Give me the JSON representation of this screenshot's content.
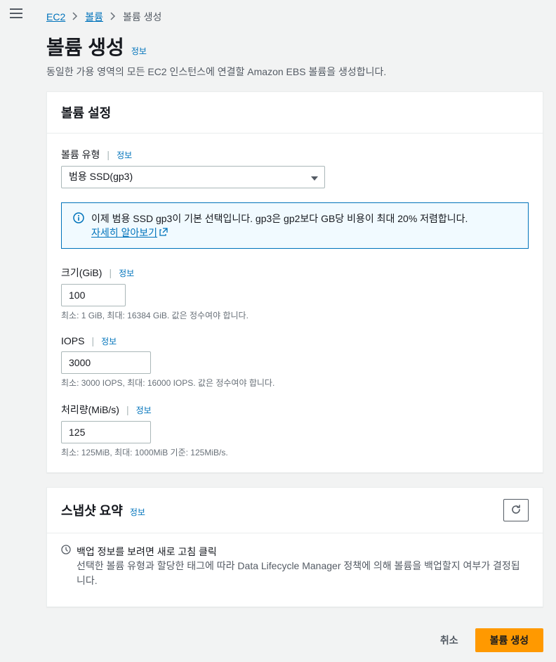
{
  "breadcrumb": {
    "items": [
      {
        "label": "EC2",
        "link": true
      },
      {
        "label": "볼륨",
        "link": true
      },
      {
        "label": "볼륨 생성",
        "link": false
      }
    ]
  },
  "page": {
    "title": "볼륨 생성",
    "info": "정보",
    "desc": "동일한 가용 영역의 모든 EC2 인스턴스에 연결할 Amazon EBS 볼륨을 생성합니다."
  },
  "settings": {
    "panel_title": "볼륨 설정",
    "type": {
      "label": "볼륨 유형",
      "info": "정보",
      "value": "범용 SSD(gp3)"
    },
    "banner": {
      "text": "이제 범용 SSD gp3이 기본 선택입니다. gp3은 gp2보다 GB당 비용이 최대 20% 저렴합니다.",
      "learn_more": "자세히 알아보기"
    },
    "size": {
      "label": "크기(GiB)",
      "info": "정보",
      "value": "100",
      "hint": "최소: 1 GiB, 최대: 16384 GiB. 값은 정수여야 합니다."
    },
    "iops": {
      "label": "IOPS",
      "info": "정보",
      "value": "3000",
      "hint": "최소: 3000 IOPS, 최대: 16000 IOPS. 값은 정수여야 합니다."
    },
    "throughput": {
      "label": "처리량(MiB/s)",
      "info": "정보",
      "value": "125",
      "hint": "최소: 125MiB, 최대: 1000MiB 기준: 125MiB/s."
    }
  },
  "snapshot": {
    "panel_title": "스냅샷 요약",
    "info": "정보",
    "title": "백업 정보를 보려면 새로 고침 클릭",
    "desc": "선택한 볼륨 유형과 할당한 태그에 따라 Data Lifecycle Manager 정책에 의해 볼륨을 백업할지 여부가 결정됩니다."
  },
  "footer": {
    "cancel": "취소",
    "submit": "볼륨 생성"
  }
}
